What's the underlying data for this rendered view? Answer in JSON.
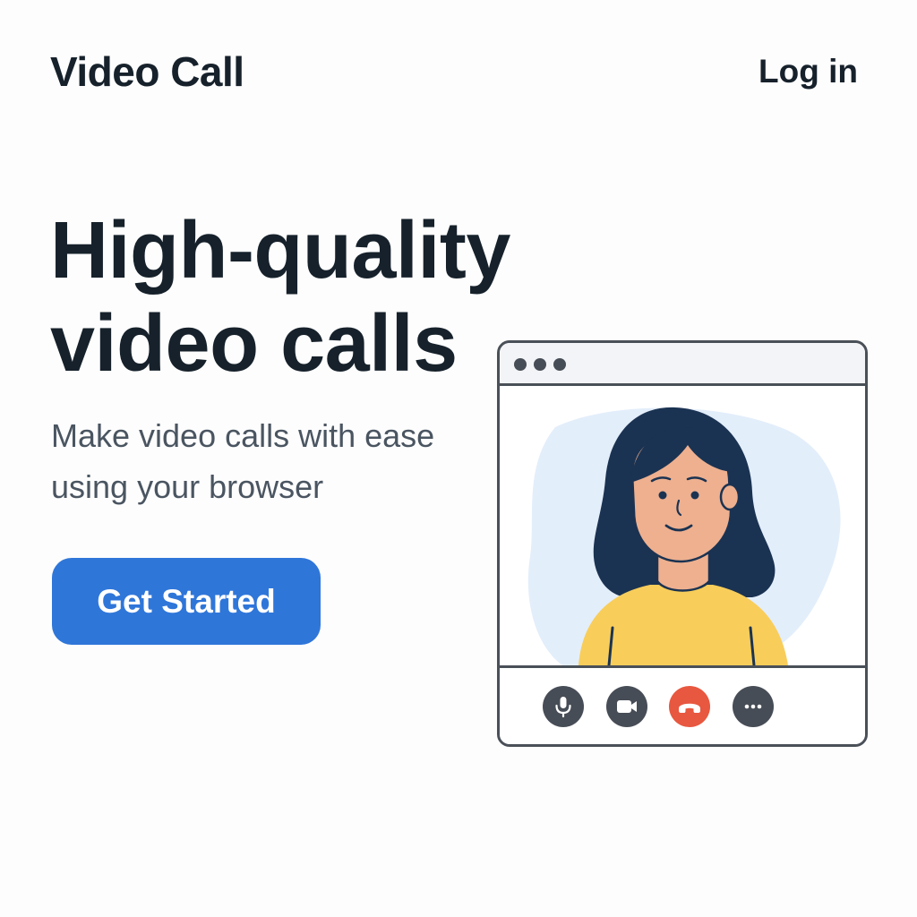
{
  "app": {
    "brand": "Video Call",
    "login_label": "Log in"
  },
  "hero": {
    "title_lines": [
      "High-quality",
      "video calls"
    ],
    "subtitle_lines": [
      "Make video calls with ease",
      "using your browser"
    ],
    "cta_label": "Get Started"
  },
  "illustration": {
    "window_dots": [
      "dot",
      "dot",
      "dot"
    ],
    "controls": [
      {
        "name": "microphone",
        "icon": "microphone-icon"
      },
      {
        "name": "camera",
        "icon": "video-camera-icon"
      },
      {
        "name": "end-call",
        "icon": "hang-up-phone-icon"
      },
      {
        "name": "more",
        "icon": "more-dots-icon"
      }
    ]
  },
  "colors": {
    "accent": "#2f76d9",
    "text": "#16212b",
    "muted_text": "#4a5561",
    "control": "#474d56",
    "end_call": "#e8573f",
    "backdrop": "#e3eefb",
    "hair": "#1b3352",
    "skin": "#eeb08f",
    "shirt": "#f8cd5a"
  }
}
